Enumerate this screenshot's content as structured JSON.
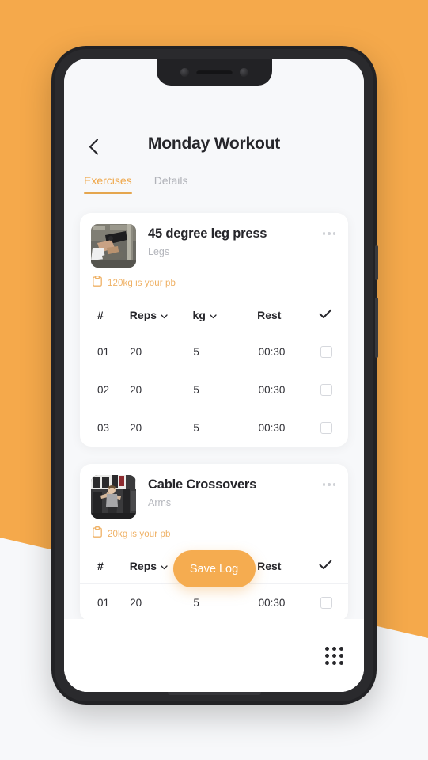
{
  "theme": {
    "accent": "#F5AC50",
    "accent_soft": "#EFB165",
    "background_orange": "#F5A94B",
    "background_light": "#F7F8FA",
    "text_dark": "#26262B",
    "text_muted": "#B4B6BC"
  },
  "appbar": {
    "back_icon": "chevron-left-icon",
    "title": "Monday Workout"
  },
  "tabs": [
    {
      "label": "Exercises",
      "active": true
    },
    {
      "label": "Details",
      "active": false
    }
  ],
  "table_headers": {
    "num": "#",
    "reps": "Reps",
    "weight": "kg",
    "rest": "Rest",
    "done_icon": "check-icon"
  },
  "exercises": [
    {
      "name": "45 degree leg press",
      "muscle_group": "Legs",
      "pb_icon": "clipboard-icon",
      "pb_text": "120kg is your pb",
      "more_icon": "more-horizontal-icon",
      "thumbnail": "leg-press-photo",
      "sets": [
        {
          "num": "01",
          "reps": "20",
          "kg": "5",
          "rest": "00:30",
          "done": false
        },
        {
          "num": "02",
          "reps": "20",
          "kg": "5",
          "rest": "00:30",
          "done": false
        },
        {
          "num": "03",
          "reps": "20",
          "kg": "5",
          "rest": "00:30",
          "done": false
        }
      ]
    },
    {
      "name": "Cable Crossovers",
      "muscle_group": "Arms",
      "pb_icon": "clipboard-icon",
      "pb_text": "20kg is your pb",
      "more_icon": "more-horizontal-icon",
      "thumbnail": "cable-crossover-photo",
      "sets": [
        {
          "num": "01",
          "reps": "20",
          "kg": "5",
          "rest": "00:30",
          "done": false
        }
      ]
    }
  ],
  "save_log": {
    "label": "Save Log"
  },
  "bottom_bar": {
    "grid_icon": "apps-grid-icon"
  }
}
